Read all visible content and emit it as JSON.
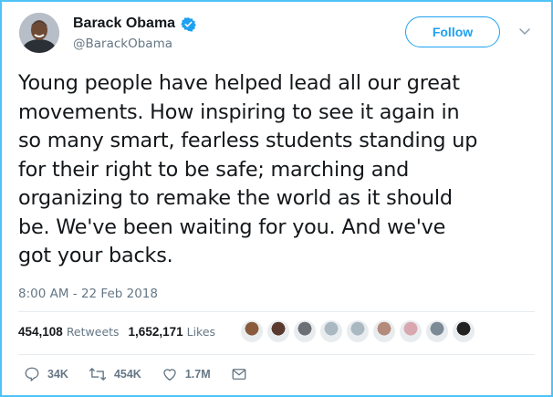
{
  "user": {
    "name": "Barack Obama",
    "handle": "@BarackObama",
    "verified": true
  },
  "follow_button": {
    "label": "Follow"
  },
  "tweet": {
    "text": "Young people have helped lead all our great\nmovements. How inspiring to see it again in\nso many smart, fearless students standing up\nfor their right to be safe; marching and\norganizing to remake the world as it should\nbe. We've been waiting for you. And we've\ngot your backs.",
    "timestamp": "8:00 AM - 22 Feb 2018"
  },
  "stats": {
    "retweets_count": "454,108",
    "retweets_label": "Retweets",
    "likes_count": "1,652,171",
    "likes_label": "Likes"
  },
  "likers": [
    {
      "name": "liker-avatar-1",
      "color": "#8a5a3c"
    },
    {
      "name": "liker-avatar-2",
      "color": "#5a3a2e"
    },
    {
      "name": "liker-avatar-3",
      "color": "#6b6f76"
    },
    {
      "name": "liker-avatar-4",
      "color": "#aab8c2"
    },
    {
      "name": "liker-avatar-5",
      "color": "#aab8c2"
    },
    {
      "name": "liker-avatar-6",
      "color": "#b48a7a"
    },
    {
      "name": "liker-avatar-7",
      "color": "#d9a7b0"
    },
    {
      "name": "liker-avatar-8",
      "color": "#7c8a96"
    },
    {
      "name": "liker-avatar-9",
      "color": "#222222"
    }
  ],
  "actions": {
    "reply_count": "34K",
    "retweet_count": "454K",
    "like_count": "1.7M"
  },
  "colors": {
    "accent": "#1da1f2",
    "muted": "#657786",
    "frame": "#4fc3f7"
  }
}
